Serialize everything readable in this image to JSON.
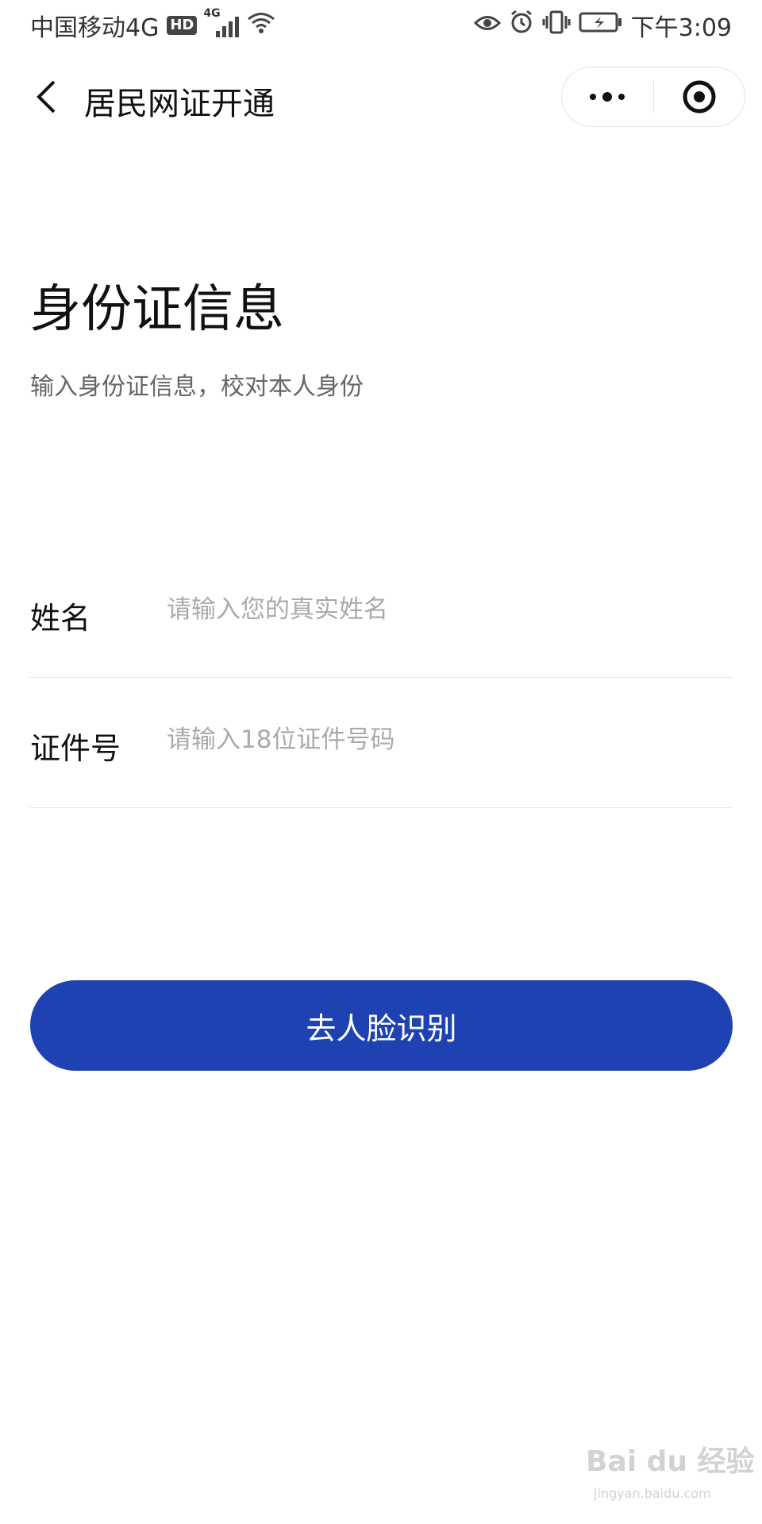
{
  "status_bar": {
    "carrier": "中国移动4G",
    "hd_badge": "HD",
    "network_small": "4G",
    "time": "下午3:09"
  },
  "navbar": {
    "title": "居民网证开通",
    "back_icon": "chevron-left-icon",
    "more_icon": "more-dots-icon",
    "close_icon": "target-circle-icon"
  },
  "main": {
    "heading": "身份证信息",
    "subheading": "输入身份证信息，校对本人身份",
    "fields": [
      {
        "label": "姓名",
        "value": "",
        "placeholder": "请输入您的真实姓名"
      },
      {
        "label": "证件号",
        "value": "",
        "placeholder": "请输入18位证件号码"
      }
    ],
    "submit_label": "去人脸识别"
  },
  "watermark": {
    "text": "Bai du 经验",
    "url_text": "jingyan.baidu.com"
  },
  "colors": {
    "primary": "#1e42b2",
    "text": "#111111",
    "subtext": "#666666",
    "placeholder": "#aaaaaa",
    "divider": "#e8e8e8"
  }
}
